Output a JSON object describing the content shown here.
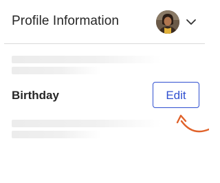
{
  "header": {
    "title": "Profile Information",
    "avatar_icon": "user-avatar-photo",
    "menu_icon": "chevron-down-icon"
  },
  "birthday_section": {
    "label": "Birthday",
    "edit_label": "Edit"
  },
  "annotation": {
    "arrow_icon": "curved-arrow-pointer-icon",
    "arrow_color": "#e0622a"
  },
  "colors": {
    "accent": "#2f4fd0",
    "text": "#262626",
    "divider": "#d9d9d9",
    "skeleton": "#ececec"
  }
}
